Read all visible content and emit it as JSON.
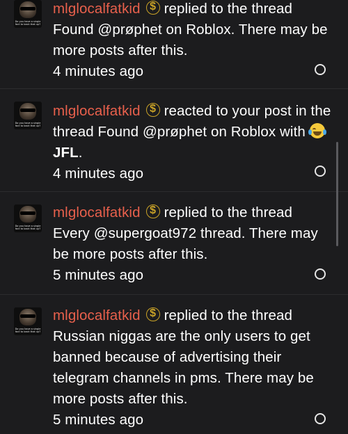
{
  "notifications": [
    {
      "username": "mlglocalfatkid",
      "avatar_caption": "Do you have a single fact to back that up?",
      "text": "replied to the thread Found @prøphet on Roblox. There may be more posts after this.",
      "time": "4 minutes ago"
    },
    {
      "username": "mlglocalfatkid",
      "avatar_caption": "Do you have a single fact to back that up?",
      "text_before": "reacted to your post in the thread Found @prøphet on Roblox with",
      "reaction": "JFL",
      "text_after": ".",
      "time": "4 minutes ago"
    },
    {
      "username": "mlglocalfatkid",
      "avatar_caption": "Do you have a single fact to back that up?",
      "text": "replied to the thread Every @supergoat972 thread. There may be more posts after this.",
      "time": "5 minutes ago"
    },
    {
      "username": "mlglocalfatkid",
      "avatar_caption": "Do you have a single fact to back that up?",
      "text": "replied to the thread Russian niggas are the only users to get banned because of advertising their telegram channels in pms. There may be more posts after this.",
      "time": "5 minutes ago"
    }
  ],
  "icons": {
    "badge": "dollar-coin-icon",
    "reaction_emoji": "tears-of-joy-icon",
    "unread": "unread-circle-icon"
  },
  "colors": {
    "background": "#1c1c1e",
    "username": "#e8604c",
    "badge": "#c9a227"
  }
}
